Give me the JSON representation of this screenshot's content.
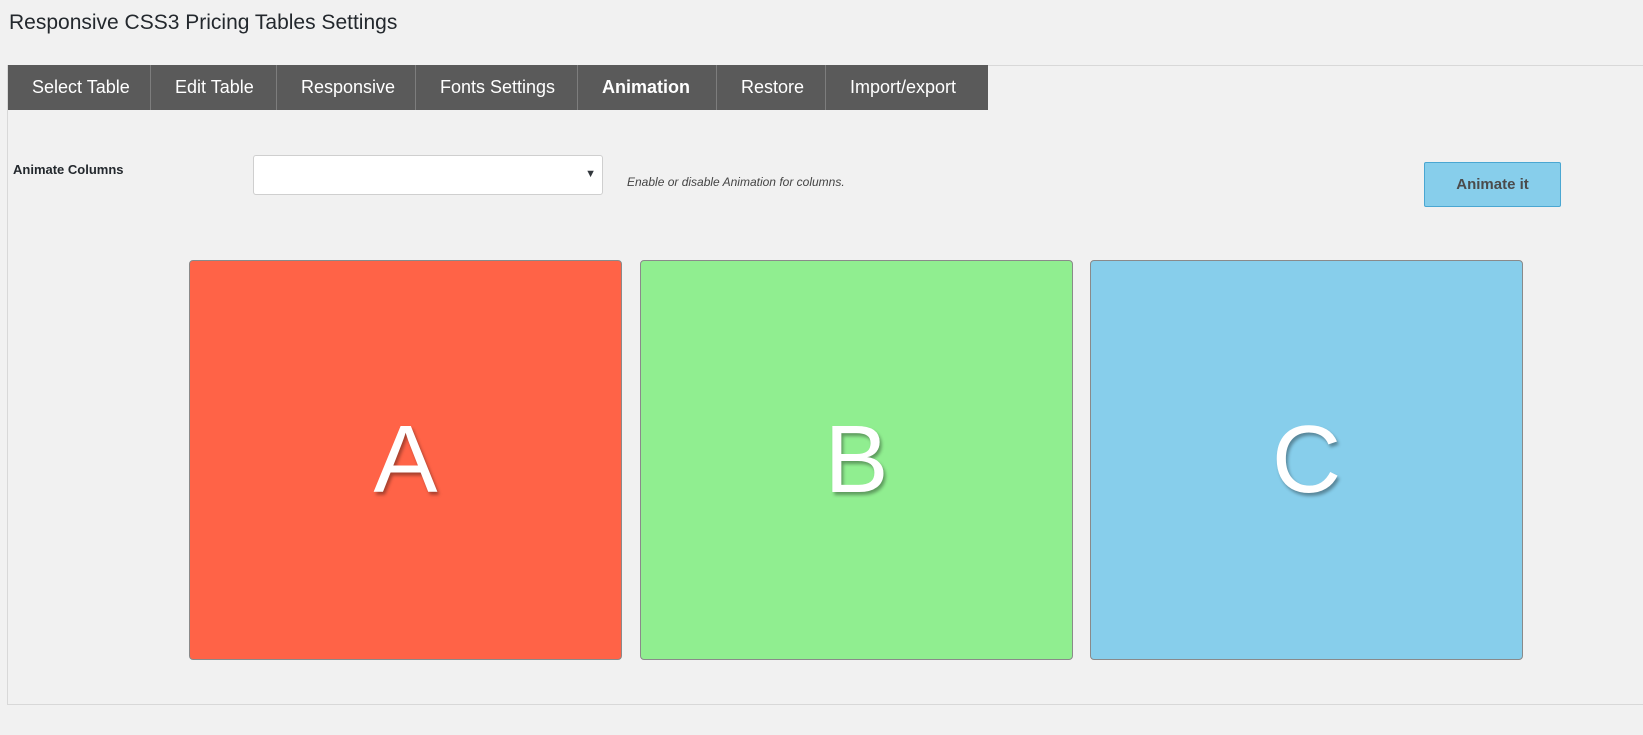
{
  "page": {
    "title": "Responsive CSS3 Pricing Tables Settings"
  },
  "tabs": [
    {
      "label": "Select Table"
    },
    {
      "label": "Edit Table"
    },
    {
      "label": "Responsive"
    },
    {
      "label": "Fonts Settings"
    },
    {
      "label": "Animation",
      "active": true
    },
    {
      "label": "Restore"
    },
    {
      "label": "Import/export"
    }
  ],
  "animation": {
    "field_label": "Animate Columns",
    "select_value": "",
    "caret_icon": "caret-down-icon",
    "help_text": "Enable or disable Animation for columns.",
    "button_label": "Animate it",
    "button_color": "#87ceeb"
  },
  "columns": [
    {
      "letter": "A",
      "color": "#ff6347"
    },
    {
      "letter": "B",
      "color": "#90ee90"
    },
    {
      "letter": "C",
      "color": "#87ceeb"
    }
  ]
}
